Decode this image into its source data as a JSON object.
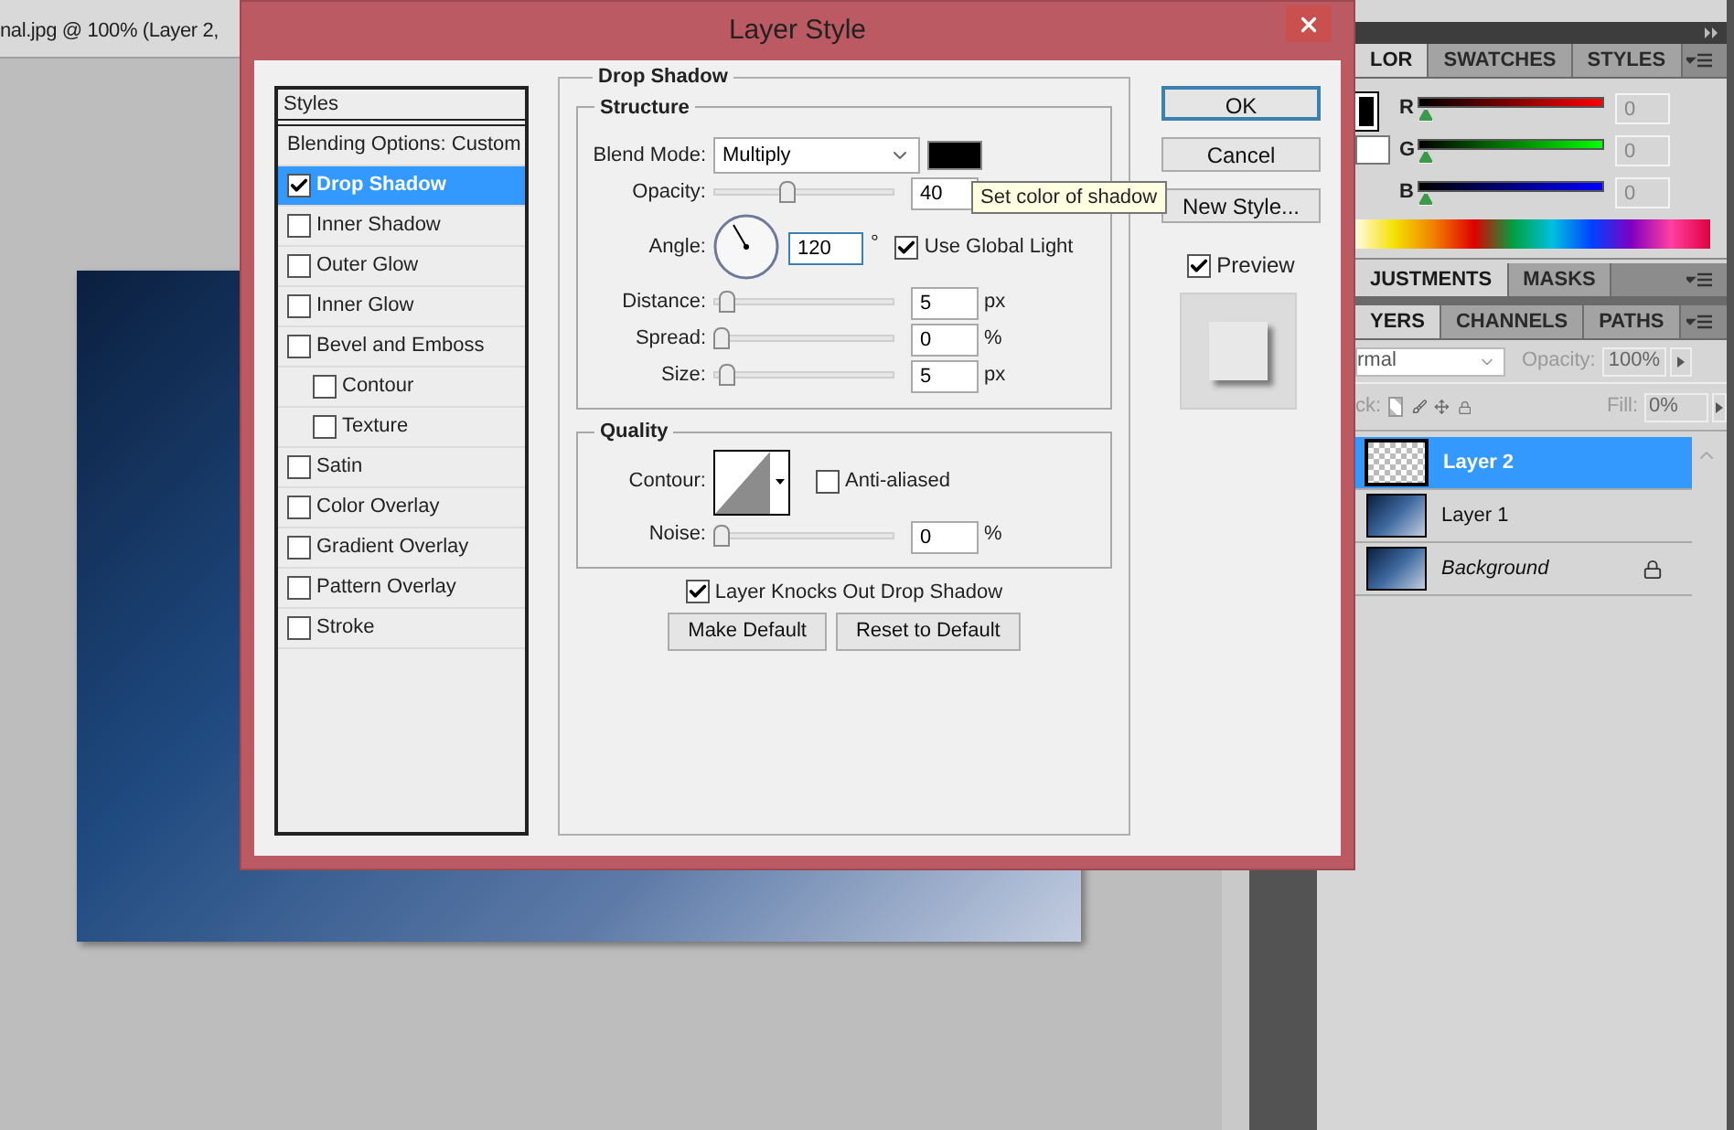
{
  "document_tab": {
    "title": "nal.jpg @ 100% (Layer 2,"
  },
  "dialog": {
    "title": "Layer Style",
    "styles_list": {
      "header": "Styles",
      "items": [
        {
          "label": "Blending Options: Custom",
          "kind": "options",
          "selected": false
        },
        {
          "label": "Drop Shadow",
          "kind": "effect",
          "checked": true,
          "selected": true
        },
        {
          "label": "Inner Shadow",
          "kind": "effect",
          "checked": false,
          "selected": false
        },
        {
          "label": "Outer Glow",
          "kind": "effect",
          "checked": false,
          "selected": false
        },
        {
          "label": "Inner Glow",
          "kind": "effect",
          "checked": false,
          "selected": false
        },
        {
          "label": "Bevel and Emboss",
          "kind": "effect",
          "checked": false,
          "selected": false,
          "children": [
            {
              "label": "Contour",
              "kind": "effect",
              "checked": false,
              "selected": false
            },
            {
              "label": "Texture",
              "kind": "effect",
              "checked": false,
              "selected": false
            }
          ]
        },
        {
          "label": "Satin",
          "kind": "effect",
          "checked": false,
          "selected": false
        },
        {
          "label": "Color Overlay",
          "kind": "effect",
          "checked": false,
          "selected": false
        },
        {
          "label": "Gradient Overlay",
          "kind": "effect",
          "checked": false,
          "selected": false
        },
        {
          "label": "Pattern Overlay",
          "kind": "effect",
          "checked": false,
          "selected": false
        },
        {
          "label": "Stroke",
          "kind": "effect",
          "checked": false,
          "selected": false
        }
      ]
    },
    "drop_shadow": {
      "title": "Drop Shadow",
      "structure": {
        "title": "Structure",
        "rows": [
          {
            "kind": "blend",
            "label": "Blend Mode:",
            "value": "Multiply"
          },
          {
            "kind": "slider",
            "label": "Opacity:",
            "value": "40",
            "level": 0.4
          },
          {
            "kind": "angle",
            "label": "Angle:",
            "value": "120",
            "unit": "°",
            "global_light": {
              "label": "Use Global Light",
              "checked": true
            }
          },
          {
            "kind": "slider",
            "label": "Distance:",
            "value": "5",
            "unit": "px",
            "level": 0.03
          },
          {
            "kind": "slider",
            "label": "Spread:",
            "value": "0",
            "unit": "%",
            "level": 0
          },
          {
            "kind": "slider",
            "label": "Size:",
            "value": "5",
            "unit": "px",
            "level": 0.03
          }
        ]
      },
      "quality": {
        "title": "Quality",
        "contour": {
          "label": "Contour:",
          "anti_aliased": {
            "label": "Anti-aliased",
            "checked": false
          }
        },
        "noise": {
          "label": "Noise:",
          "value": "0",
          "unit": "%",
          "level": 0
        }
      },
      "knockout": {
        "label": "Layer Knocks Out Drop Shadow",
        "checked": true
      },
      "buttons": [
        "Make Default",
        "Reset to Default"
      ]
    },
    "side_buttons": [
      {
        "label": "OK",
        "default": true
      },
      {
        "label": "Cancel",
        "default": false
      },
      {
        "label": "New Style...",
        "default": false
      }
    ],
    "preview": {
      "label": "Preview",
      "checked": true
    },
    "tooltip": "Set color of shadow"
  },
  "color_panel": {
    "tabs": [
      {
        "label": "LOR",
        "selected": true
      },
      {
        "label": "SWATCHES",
        "selected": false
      },
      {
        "label": "STYLES",
        "selected": false
      }
    ],
    "channels": [
      {
        "label": "R",
        "value": "0",
        "level": 0
      },
      {
        "label": "G",
        "value": "0",
        "level": 0
      },
      {
        "label": "B",
        "value": "0",
        "level": 0
      }
    ]
  },
  "adjustments_panel": {
    "tabs": [
      {
        "label": "JUSTMENTS",
        "selected": true
      },
      {
        "label": "MASKS",
        "selected": false
      }
    ]
  },
  "layers_panel": {
    "tabs": [
      {
        "label": "YERS",
        "selected": true
      },
      {
        "label": "CHANNELS",
        "selected": false
      },
      {
        "label": "PATHS",
        "selected": false
      }
    ],
    "blend_mode": "rmal",
    "opacity": {
      "label": "Opacity:",
      "value": "100%"
    },
    "lock_label": "ck:",
    "fill": {
      "label": "Fill:",
      "value": "0%"
    },
    "layers": [
      {
        "name": "Layer 2",
        "kind": "transparent",
        "selected": true
      },
      {
        "name": "Layer 1",
        "kind": "photo",
        "selected": false
      },
      {
        "name": "Background",
        "kind": "background",
        "selected": false
      }
    ]
  }
}
